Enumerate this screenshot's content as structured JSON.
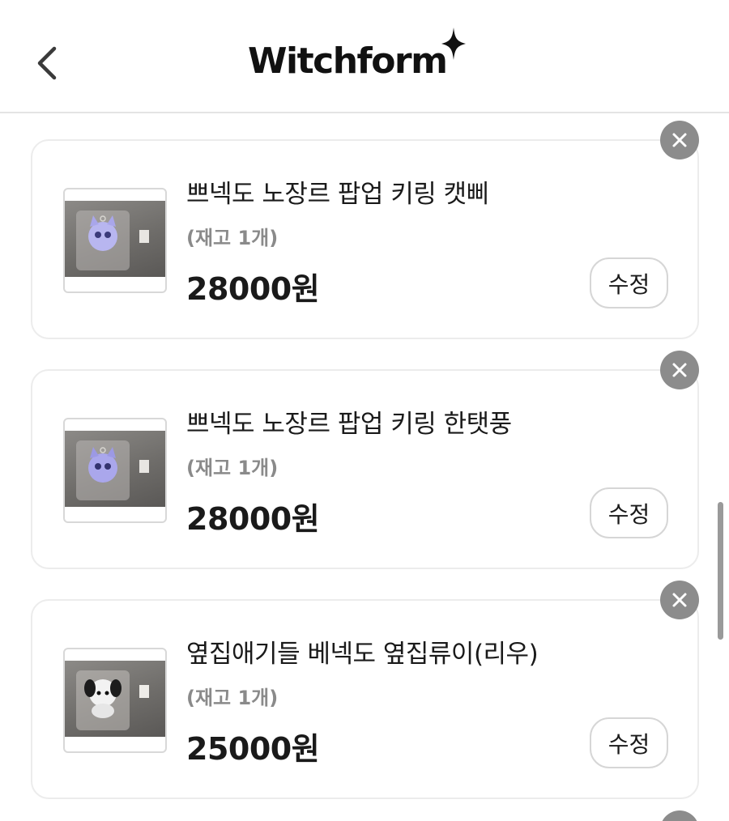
{
  "header": {
    "back_icon": "chevron-left-icon",
    "logo_text": "Witchform",
    "logo_star_icon": "sparkle-icon"
  },
  "items": [
    {
      "title": "쁘넥도 노장르 팝업 키링 캣삐",
      "stock": "(재고 1개)",
      "price": "28000원",
      "edit_label": "수정",
      "remove_icon": "close-icon",
      "thumb_icon": "plush-keyring-cat"
    },
    {
      "title": "쁘넥도 노장르 팝업 키링 한탯풍",
      "stock": "(재고 1개)",
      "price": "28000원",
      "edit_label": "수정",
      "remove_icon": "close-icon",
      "thumb_icon": "plush-keyring-cat"
    },
    {
      "title": "옆집애기들 베넥도 옆집류이(리우)",
      "stock": "(재고 1개)",
      "price": "25000원",
      "edit_label": "수정",
      "remove_icon": "close-icon",
      "thumb_icon": "plush-keyring-dog"
    }
  ],
  "colors": {
    "remove_bg": "#8c8c8c",
    "stock_text": "#8a8a8a",
    "card_border": "#ececec"
  }
}
